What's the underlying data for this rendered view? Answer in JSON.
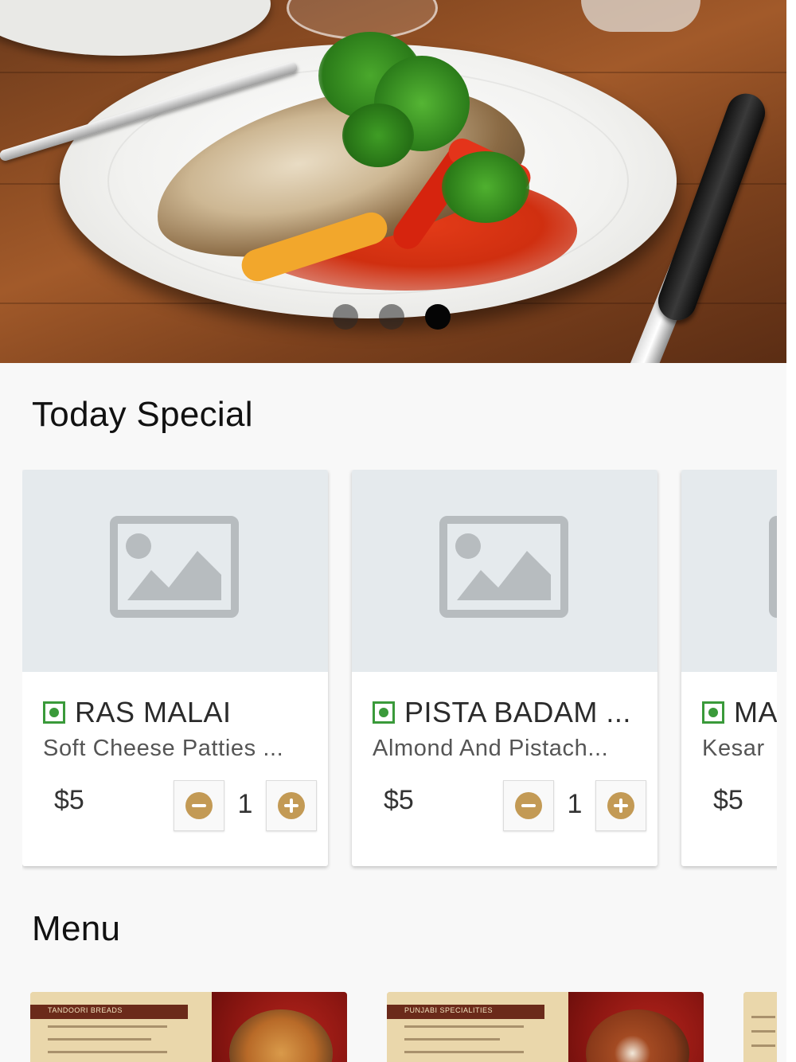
{
  "hero": {
    "carousel": {
      "slide_count": 3,
      "active_slide": 3
    }
  },
  "today_special": {
    "title": "Today Special",
    "items": [
      {
        "name": "RAS MALAI",
        "description": "Soft Cheese Patties ...",
        "price": "$5",
        "quantity": "1"
      },
      {
        "name": "PISTA BADAM ...",
        "description": "Almond And Pistach...",
        "price": "$5",
        "quantity": "1"
      },
      {
        "name": "MA",
        "description": "Kesar",
        "price": "$5"
      }
    ]
  },
  "menu": {
    "title": "Menu",
    "thumbnails": [
      {
        "heading": "TANDOORI BREADS"
      },
      {
        "heading": "PUNJABI SPECIALITIES"
      },
      {
        "heading": ""
      }
    ]
  },
  "colors": {
    "veg_indicator": "#3a9a3a",
    "qty_button_accent": "#c39a55",
    "placeholder_bg": "#e5eaed",
    "page_bg": "#f8f8f8"
  }
}
